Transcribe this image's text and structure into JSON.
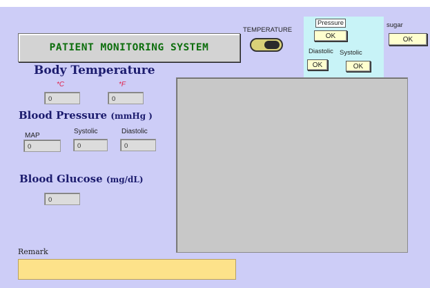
{
  "title": "PATIENT MONITORING SYSTEM",
  "body_temperature": {
    "heading": "Body Temperature",
    "celsius_label": "*C",
    "fahrenheit_label": "*F",
    "celsius_value": "0",
    "fahrenheit_value": "0"
  },
  "blood_pressure": {
    "heading": "Blood Pressure",
    "unit": "(mmHg )",
    "map_label": "MAP",
    "systolic_label": "Systolic",
    "diastolic_label": "Diastolic",
    "map_value": "0",
    "systolic_value": "0",
    "diastolic_value": "0"
  },
  "blood_glucose": {
    "heading": "Blood Glucose",
    "unit": "(mg/dL)",
    "value": "0"
  },
  "temperature_control": {
    "label": "TEMPERATURE"
  },
  "pressure_panel": {
    "label": "Pressure",
    "ok_label": "OK",
    "diastolic_label": "Diastolic",
    "systolic_label": "Systolic",
    "diastolic_ok": "OK",
    "systolic_ok": "OK"
  },
  "sugar_panel": {
    "label": "sugar",
    "ok_label": "OK"
  },
  "remark": {
    "label": "Remark",
    "value": ""
  },
  "colors": {
    "panel_background": "#cdcdf7",
    "title_text": "#0c6e0c",
    "heading_text": "#1c1c6e",
    "button_fill": "#ffffcf",
    "pressure_panel": "#c8f3f7",
    "remark_box": "#fde28a"
  }
}
